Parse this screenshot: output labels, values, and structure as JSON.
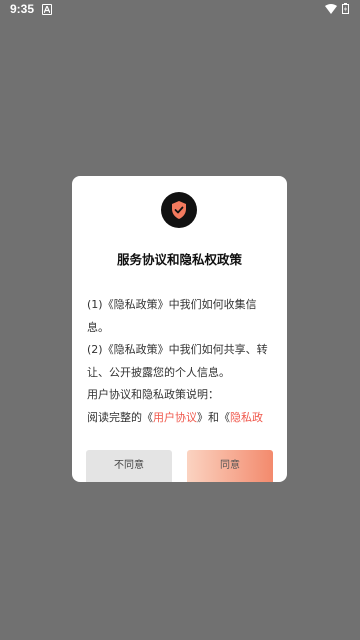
{
  "status_bar": {
    "time": "9:35"
  },
  "dialog": {
    "title": "服务协议和隐私权政策",
    "lines": {
      "l1": "(1)《隐私政策》中我们如何收集信息。",
      "l2": "(2)《隐私政策》中我们如何共享、转让、公开披露您的个人信息。",
      "l3": "用户协议和隐私政策说明：",
      "l4_prefix": "阅读完整的《",
      "l4_link1": "用户协议",
      "l4_mid": "》和《",
      "l4_link2": "隐私政策"
    },
    "decline_label": "不同意",
    "agree_label": "同意"
  },
  "colors": {
    "overlay": "#717171",
    "link": "#f0584c",
    "shield": "#f37a5e",
    "agree_gradient_start": "#fbd3c1",
    "agree_gradient_end": "#f38a6d"
  },
  "icons": {
    "dialog_icon": "shield-check-icon",
    "status_notification": "notification-a-icon",
    "status_wifi": "wifi-icon",
    "status_battery": "battery-icon"
  }
}
